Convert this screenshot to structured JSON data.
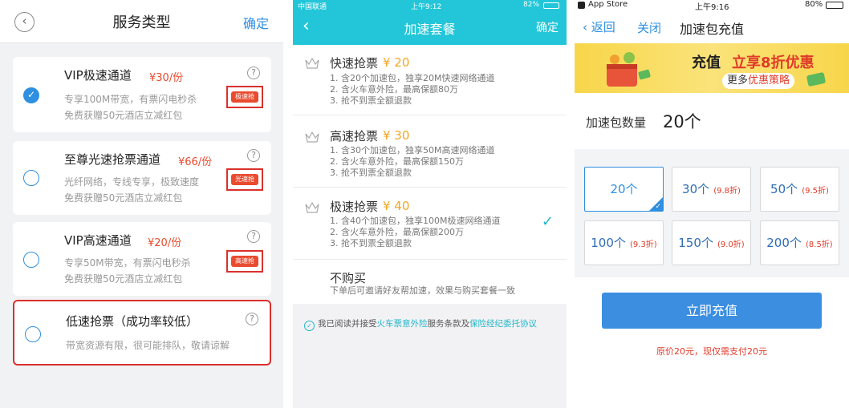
{
  "panel1": {
    "title": "服务类型",
    "confirm": "确定",
    "back_glyph": "‹",
    "help_glyph": "?",
    "check_glyph": "✓",
    "cards": [
      {
        "title": "VIP极速通道",
        "price": "¥30/份",
        "line1": "专享100M带宽，有票闪电秒杀",
        "line2": "免费获赠50元酒店立减红包",
        "badge": "极速抢",
        "selected": true
      },
      {
        "title": "至尊光速抢票通道",
        "price": "¥66/份",
        "line1": "光纤网络，专线专享，极致速度",
        "line2": "免费获赠50元酒店立减红包",
        "badge": "光速抢",
        "selected": false
      },
      {
        "title": "VIP高速通道",
        "price": "¥20/份",
        "line1": "专享50M带宽，有票闪电秒杀",
        "line2": "免费获赠50元酒店立减红包",
        "badge": "高速抢",
        "selected": false
      },
      {
        "title": "低速抢票（成功率较低）",
        "line1": "带宽资源有限，很可能排队，敬请谅解",
        "selected": false
      }
    ]
  },
  "panel2": {
    "status": {
      "carrier": "中国联通",
      "time": "上午9:12",
      "battery": "82%"
    },
    "title": "加速套餐",
    "confirm": "确定",
    "back_glyph": "‹",
    "check_glyph": "✓",
    "packages": [
      {
        "name": "快速抢票",
        "price": "¥ 20",
        "lines": [
          "1. 含20个加速包，独享20M快速网络通道",
          "2. 含火车意外险，最高保额80万",
          "3. 抢不到票全额退款"
        ],
        "selected": false
      },
      {
        "name": "高速抢票",
        "price": "¥ 30",
        "lines": [
          "1. 含30个加速包，独享50M高速网络通道",
          "2. 含火车意外险，最高保额150万",
          "3. 抢不到票全额退款"
        ],
        "selected": false
      },
      {
        "name": "极速抢票",
        "price": "¥ 40",
        "lines": [
          "1. 含40个加速包，独享100M极速网络通道",
          "2. 含火车意外险，最高保额200万",
          "3. 抢不到票全额退款"
        ],
        "selected": true
      }
    ],
    "no_buy": {
      "title": "不购买",
      "desc": "下单后可邀请好友帮加速，效果与购买套餐一致"
    },
    "agree": {
      "prefix": "我已阅读并接受",
      "link1": "火车票意外险",
      "middle": "服务条款及",
      "link2": "保险经纪委托协议"
    }
  },
  "panel3": {
    "status": {
      "app": "App Store",
      "time": "上午9:16",
      "battery": "80%"
    },
    "back": "‹ 返回",
    "close": "关闭",
    "title": "加速包充值",
    "banner": {
      "headline": "充值",
      "headline_red": "立享8折优惠",
      "pill_prefix": "更多",
      "pill_red": "优惠策略"
    },
    "qty_label": "加速包数量",
    "qty_value": "20个",
    "options": [
      {
        "count": "20个",
        "discount": "",
        "active": true
      },
      {
        "count": "30个",
        "discount": "(9.8折)",
        "active": false
      },
      {
        "count": "50个",
        "discount": "(9.5折)",
        "active": false
      },
      {
        "count": "100个",
        "discount": "(9.3折)",
        "active": false
      },
      {
        "count": "150个",
        "discount": "(9.0折)",
        "active": false
      },
      {
        "count": "200个",
        "discount": "(8.5折)",
        "active": false
      }
    ],
    "pay_button": "立即充值",
    "price_note": "原价20元，现仅需支付20元"
  },
  "colors": {
    "accent_blue": "#2f8fe0",
    "teal": "#23c6d8",
    "price_red": "#e94b2f",
    "orange": "#f5a623",
    "highlight_red": "#d9312c"
  }
}
